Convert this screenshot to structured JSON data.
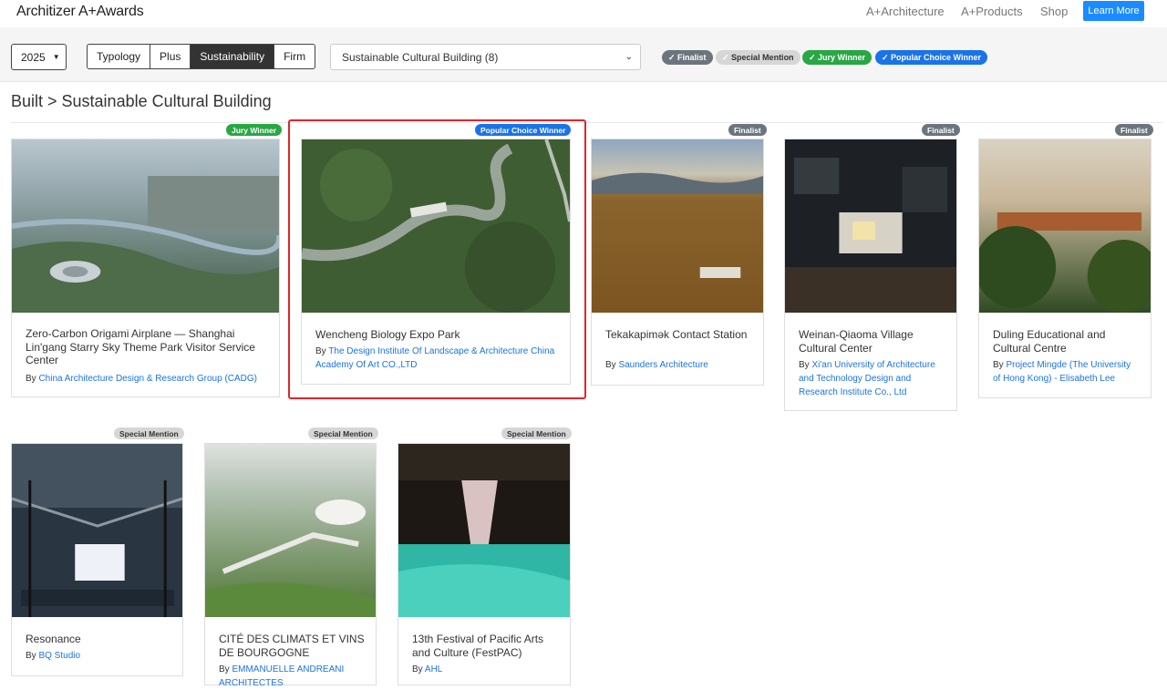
{
  "header": {
    "logo": "Architizer A+Awards",
    "nav": [
      "A+Architecture",
      "A+Products",
      "Shop"
    ],
    "learn_more": "Learn More"
  },
  "filters": {
    "year": "2025",
    "segments": [
      "Typology",
      "Plus",
      "Sustainability",
      "Firm"
    ],
    "active_segment": "Sustainability",
    "category_select": "Sustainable Cultural Building (8)",
    "status_chips": [
      {
        "label": "Finalist",
        "color": "#6c757d"
      },
      {
        "label": "Special Mention",
        "color": "#d6d6d6"
      },
      {
        "label": "Jury Winner",
        "color": "#28a745"
      },
      {
        "label": "Popular Choice Winner",
        "color": "#1a73e8"
      }
    ]
  },
  "breadcrumb": "Built > Sustainable Cultural Building",
  "cards": [
    {
      "badge": "Jury Winner",
      "title": "Zero-Carbon Origami Airplane — Shanghai Lin'gang Starry Sky Theme Park Visitor Service Center",
      "by": "By",
      "firm": "China Architecture Design & Research Group (CADG)"
    },
    {
      "badge": "Popular Choice Winner",
      "title": "Wencheng Biology Expo Park",
      "by": "By",
      "firm": "The Design Institute Of Landscape & Architecture China Academy Of Art CO.,LTD"
    },
    {
      "badge": "Finalist",
      "title": "Tekakapimək Contact Station",
      "by": "By",
      "firm": "Saunders Architecture"
    },
    {
      "badge": "Finalist",
      "title": "Weinan-Qiaoma Village Cultural Center",
      "by": "By",
      "firm": "Xi'an University of Architecture and Technology Design and Research Institute Co., Ltd"
    },
    {
      "badge": "Finalist",
      "title": "Duling Educational and Cultural Centre",
      "by": "By",
      "firm": "Project Mingde (The University of Hong Kong) - Elisabeth Lee"
    },
    {
      "badge": "Special Mention",
      "title": "Resonance",
      "by": "By",
      "firm": "BQ Studio"
    },
    {
      "badge": "Special Mention",
      "title": "CITÉ DES CLIMATS ET VINS DE BOURGOGNE",
      "by": "By",
      "firm": "EMMANUELLE ANDREANI ARCHITECTES"
    },
    {
      "badge": "Special Mention",
      "title": "13th Festival of Pacific Arts and Culture (FestPAC)",
      "by": "By",
      "firm": "AHL"
    }
  ]
}
